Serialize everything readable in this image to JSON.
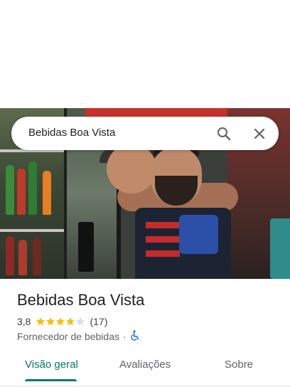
{
  "search": {
    "query": "Bebidas Boa Vista",
    "search_icon": "search-icon",
    "close_icon": "close-icon"
  },
  "place": {
    "name": "Bebidas Boa Vista",
    "rating": "3,8",
    "rating_stars": 3.8,
    "reviews": "(17)",
    "category": "Fornecedor de bebidas",
    "separator": "·",
    "accessibility_icon": "wheelchair-icon"
  },
  "tabs": [
    {
      "label": "Visão geral",
      "active": true
    },
    {
      "label": "Avaliações",
      "active": false
    },
    {
      "label": "Sobre",
      "active": false
    }
  ],
  "colors": {
    "accent": "#00796b",
    "star": "#fbbc04",
    "star_empty": "#dadce0",
    "accessibility": "#1a73e8"
  }
}
